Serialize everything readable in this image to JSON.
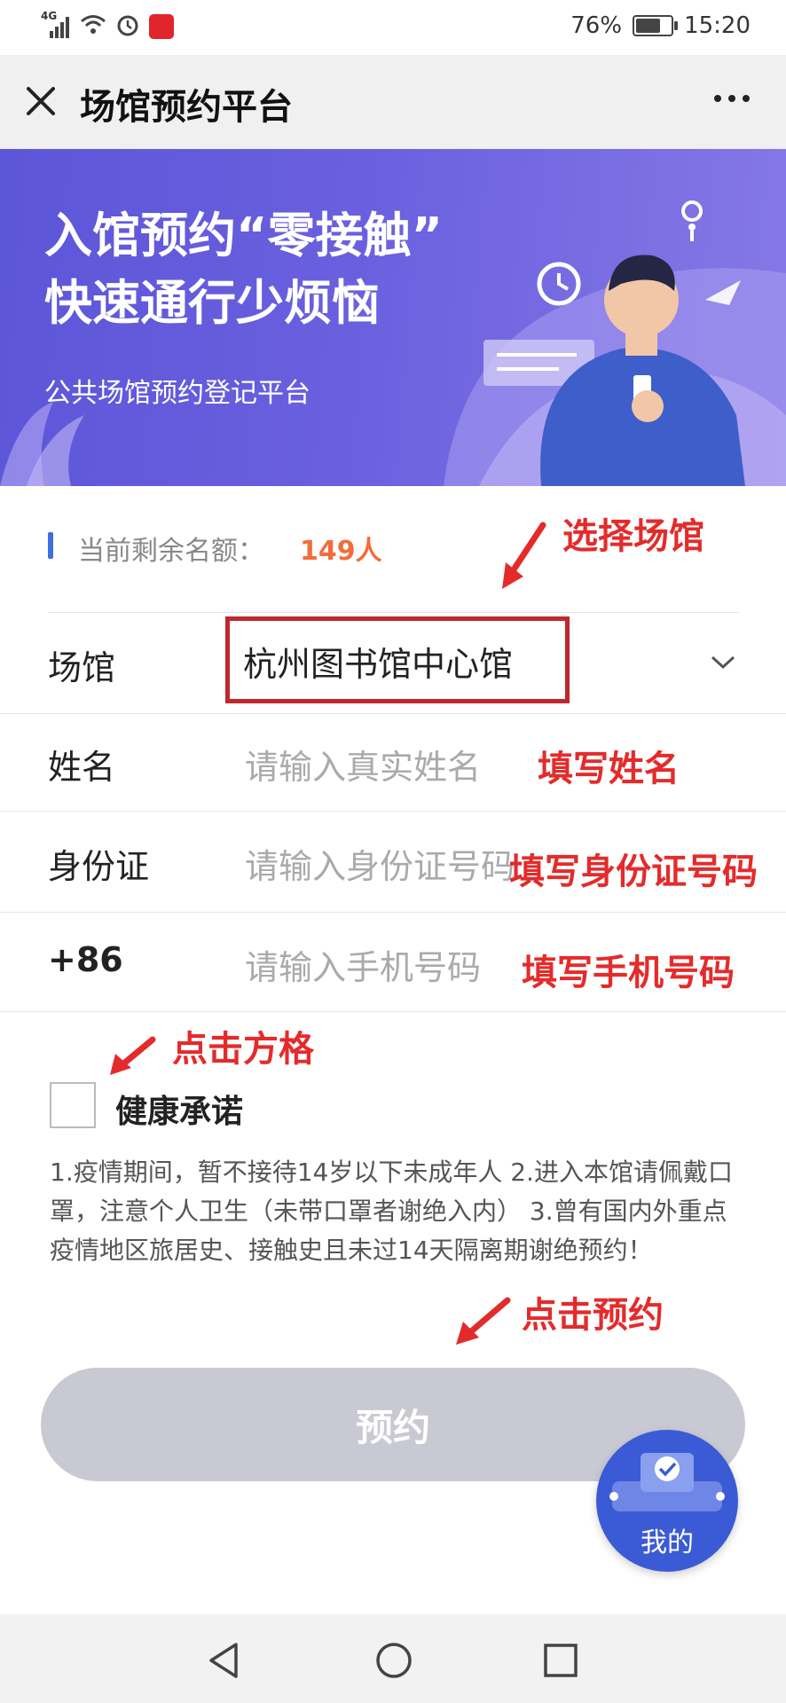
{
  "status_bar": {
    "network": "4G",
    "battery_percent": "76%",
    "battery_level": 0.76,
    "time": "15:20",
    "icons": [
      "signal-icon",
      "wifi-icon",
      "alarm-icon",
      "app-notification-icon",
      "battery-icon"
    ]
  },
  "titlebar": {
    "title": "场馆预约平台",
    "close_icon": "close-icon",
    "more_icon": "more-icon"
  },
  "banner": {
    "headline_line1": "入馆预约“零接触”",
    "headline_line2": "快速通行少烦恼",
    "subtitle": "公共场馆预约登记平台"
  },
  "quota": {
    "label": "当前剩余名额：",
    "value": "149人"
  },
  "form": {
    "venue": {
      "label": "场馆",
      "value": "杭州图书馆中心馆"
    },
    "name": {
      "label": "姓名",
      "placeholder": "请输入真实姓名"
    },
    "id_card": {
      "label": "身份证",
      "placeholder": "请输入身份证号码"
    },
    "phone": {
      "label": "+86",
      "placeholder": "请输入手机号码"
    }
  },
  "annotations": {
    "select_venue": "选择场馆",
    "fill_name": "填写姓名",
    "fill_id": "填写身份证号码",
    "fill_phone": "填写手机号码",
    "click_checkbox": "点击方格",
    "click_submit": "点击预约"
  },
  "health": {
    "label": "健康承诺",
    "rules": "1.疫情期间，暂不接待14岁以下未成年人 2.进入本馆请佩戴口罩，注意个人卫生（未带口罩者谢绝入内） 3.曾有国内外重点疫情地区旅居史、接触史且未过14天隔离期谢绝预约！"
  },
  "submit_label": "预约",
  "floating": {
    "label": "我的"
  },
  "colors": {
    "banner_start": "#5c56d8",
    "banner_end": "#8678e6",
    "accent_blue": "#3d6fe0",
    "quota_orange": "#f26d3d",
    "annotation_red": "#e42b2b",
    "button_disabled": "#c8c9d2"
  }
}
